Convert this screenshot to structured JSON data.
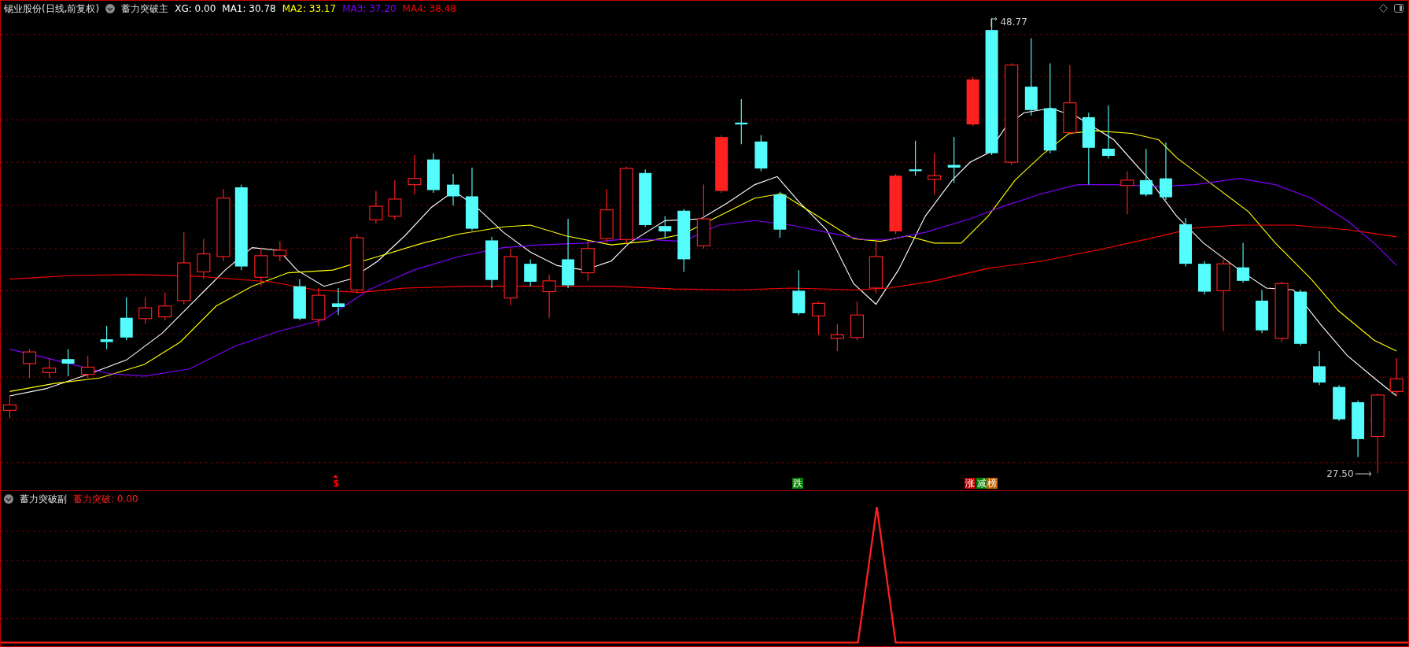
{
  "main_panel": {
    "title": "锡业股份(日线,前复权)",
    "indicator": "蓄力突破主",
    "values": [
      {
        "label": "XG: 0.00",
        "color": "#ffffff"
      },
      {
        "label": "MA1: 30.78",
        "color": "#ffffff"
      },
      {
        "label": "MA2: 33.17",
        "color": "#ffff00"
      },
      {
        "label": "MA3: 37.20",
        "color": "#8000ff"
      },
      {
        "label": "MA4: 38.48",
        "color": "#ff0000"
      }
    ],
    "high_label": "48.77",
    "low_label": "27.50",
    "markers": [
      {
        "kind": "text",
        "text": "$",
        "color": "#ff0000"
      },
      {
        "kind": "tag",
        "text": "跌",
        "color": "#008000"
      },
      {
        "kind": "tag",
        "text": "涨",
        "color": "#c00000"
      },
      {
        "kind": "tag",
        "text": "减",
        "color": "#008000"
      },
      {
        "kind": "tag",
        "text": "榜",
        "color": "#c06000"
      }
    ]
  },
  "sub_panel": {
    "title": "蓄力突破副",
    "value": "蓄力突破: 0.00"
  }
}
